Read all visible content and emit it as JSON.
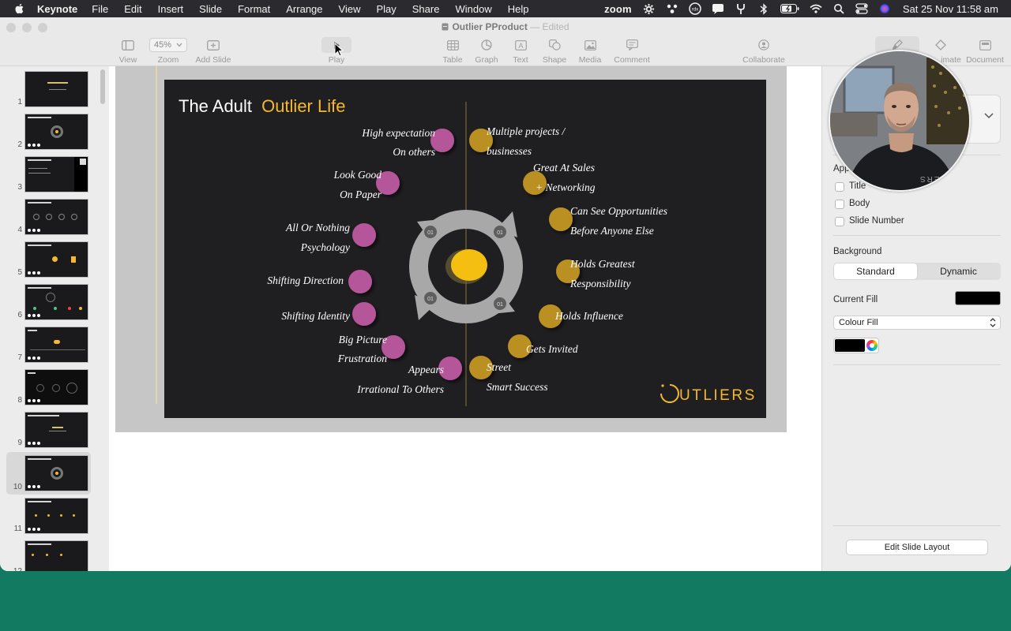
{
  "menubar": {
    "app_name": "Keynote",
    "items": [
      "File",
      "Edit",
      "Insert",
      "Slide",
      "Format",
      "Arrange",
      "View",
      "Play",
      "Share",
      "Window",
      "Help"
    ],
    "zoom_label": "zoom",
    "datetime": "Sat 25 Nov  11:58 am"
  },
  "window": {
    "doc_title": "Outlier PProduct",
    "edited_label": "— Edited"
  },
  "toolbar": {
    "view": "View",
    "zoom": "Zoom",
    "zoom_value": "45%",
    "add_slide": "Add Slide",
    "play": "Play",
    "table": "Table",
    "graph": "Graph",
    "text": "Text",
    "shape": "Shape",
    "media": "Media",
    "comment": "Comment",
    "collaborate": "Collaborate",
    "animate": "imate",
    "document": "Document"
  },
  "navigator": {
    "slides": [
      "1",
      "2",
      "3",
      "4",
      "5",
      "6",
      "7",
      "8",
      "9",
      "10",
      "11",
      "12"
    ],
    "selected": "10"
  },
  "slide": {
    "title_white": "The Adult",
    "title_gold": "Outlier Life",
    "logo_text": "UTLIERS",
    "cycle_badge": "01",
    "left_labels": [
      [
        "High expectation",
        "On others"
      ],
      [
        "Look Good",
        "On Paper"
      ],
      [
        "All Or Nothing",
        "Psychology"
      ],
      [
        "Shifting  Direction"
      ],
      [
        "Shifting Identity"
      ],
      [
        "Big Picture",
        "Frustration"
      ],
      [
        "Appears",
        "Irrational To Others"
      ]
    ],
    "right_labels": [
      [
        "Multiple projects /",
        "businesses"
      ],
      [
        "Great At Sales",
        "+ Networking"
      ],
      [
        "Can See Opportunities",
        "Before Anyone Else"
      ],
      [
        "Holds Greatest",
        "Responsibility"
      ],
      [
        "Holds Influence"
      ],
      [
        "Gets Invited"
      ],
      [
        "Street",
        "Smart Success"
      ]
    ],
    "colors": {
      "gold": "#f5b82e",
      "magenta": "#b5559a",
      "background": "#1f1f22"
    }
  },
  "inspector": {
    "appearance_label": "App",
    "checkboxes": [
      "Title",
      "Body",
      "Slide Number"
    ],
    "background_label": "Background",
    "seg_standard": "Standard",
    "seg_dynamic": "Dynamic",
    "current_fill_label": "Current Fill",
    "fill_type": "Colour Fill",
    "edit_layout": "Edit Slide Layout"
  },
  "webcam": {
    "shirt_text": "UTLIERS"
  }
}
